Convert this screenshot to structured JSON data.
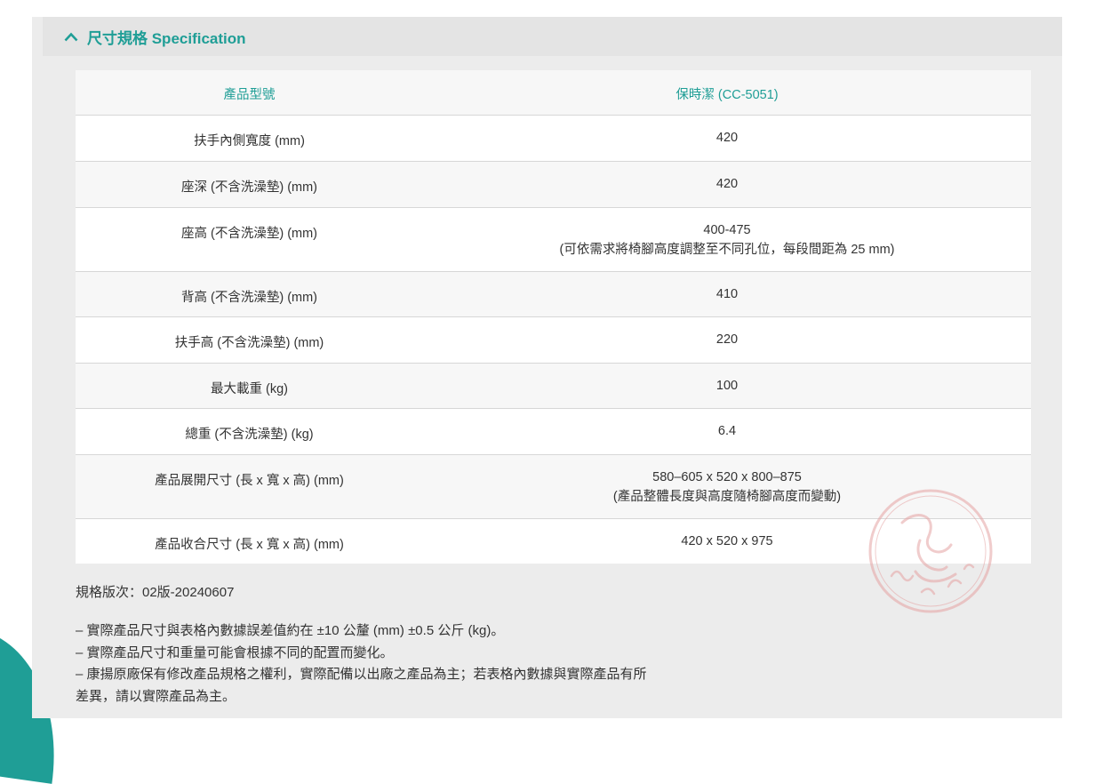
{
  "section": {
    "title": "尺寸規格 Specification"
  },
  "table": {
    "header": {
      "label": "產品型號",
      "value": "保時潔 (CC-5051)"
    },
    "rows": [
      {
        "label": "扶手內側寬度 (mm)",
        "value": "420",
        "sub": ""
      },
      {
        "label": "座深 (不含洗澡墊) (mm)",
        "value": "420",
        "sub": ""
      },
      {
        "label": "座高 (不含洗澡墊) (mm)",
        "value": "400-475",
        "sub": "(可依需求將椅腳高度調整至不同孔位，每段間距為 25 mm)"
      },
      {
        "label": "背高 (不含洗澡墊) (mm)",
        "value": "410",
        "sub": ""
      },
      {
        "label": "扶手高 (不含洗澡墊) (mm)",
        "value": "220",
        "sub": ""
      },
      {
        "label": "最大載重 (kg)",
        "value": "100",
        "sub": ""
      },
      {
        "label": "總重 (不含洗澡墊) (kg)",
        "value": "6.4",
        "sub": ""
      },
      {
        "label": "產品展開尺寸 (長 x 寬 x 高) (mm)",
        "value": "580–605 x 520 x 800–875",
        "sub": "(產品整體長度與高度隨椅腳高度而變動)"
      },
      {
        "label": "產品收合尺寸 (長 x 寬 x 高) (mm)",
        "value": "420 x 520 x 975",
        "sub": ""
      }
    ]
  },
  "version": "規格版次：02版-20240607",
  "notes": [
    "– 實際產品尺寸與表格內數據誤差值約在 ±10 公釐 (mm) ±0.5 公斤 (kg)。",
    "– 實際產品尺寸和重量可能會根據不同的配置而變化。",
    "– 康揚原廠保有修改產品規格之權利，實際配備以出廠之產品為主；若表格內數據與實際產品有所",
    "差異，請以實際產品為主。"
  ],
  "colors": {
    "accent": "#1f9e96",
    "stamp": "#e5a3a3"
  },
  "icons": {
    "collapse": "chevron-up-icon",
    "watermark": "seal-stamp-icon"
  }
}
